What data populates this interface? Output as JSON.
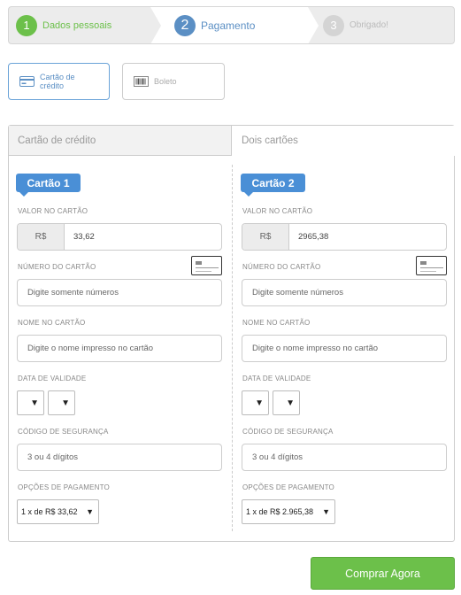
{
  "stepper": {
    "steps": [
      {
        "num": "1",
        "label": "Dados pessoais"
      },
      {
        "num": "2",
        "label": "Pagamento"
      },
      {
        "num": "3",
        "label": "Obrigado!"
      }
    ]
  },
  "methods": {
    "card": "Cartão de crédito",
    "boleto": "Boleto"
  },
  "tabs": {
    "single": "Cartão de crédito",
    "double": "Dois cartões"
  },
  "cards": [
    {
      "badge": "Cartão 1",
      "amount_label": "VALOR NO CARTÃO",
      "currency": "R$",
      "amount": "33,62",
      "number_label": "NÚMERO DO CARTÃO",
      "number_placeholder": "Digite somente números",
      "name_label": "NOME NO CARTÃO",
      "name_placeholder": "Digite o nome impresso no cartão",
      "expiry_label": "DATA DE VALIDADE",
      "cvv_label": "CÓDIGO DE SEGURANÇA",
      "cvv_placeholder": "3 ou 4 dígitos",
      "installments_label": "OPÇÕES DE PAGAMENTO",
      "installments_value": "1 x de R$ 33,62"
    },
    {
      "badge": "Cartão 2",
      "amount_label": "VALOR NO CARTÃO",
      "currency": "R$",
      "amount": "2965,38",
      "number_label": "NÚMERO DO CARTÃO",
      "number_placeholder": "Digite somente números",
      "name_label": "NOME NO CARTÃO",
      "name_placeholder": "Digite o nome impresso no cartão",
      "expiry_label": "DATA DE VALIDADE",
      "cvv_label": "CÓDIGO DE SEGURANÇA",
      "cvv_placeholder": "3 ou 4 dígitos",
      "installments_label": "OPÇÕES DE PAGAMENTO",
      "installments_value": "1 x de R$ 2.965,38"
    }
  ],
  "buy_button": "Comprar Agora",
  "icons": {
    "card_method": "credit-card-icon",
    "boleto_method": "barcode-icon",
    "card_illustration": "credit-card-icon",
    "dropdown": "caret-down-icon"
  },
  "colors": {
    "accent_green": "#6cc04a",
    "accent_blue": "#4a8fd6"
  }
}
